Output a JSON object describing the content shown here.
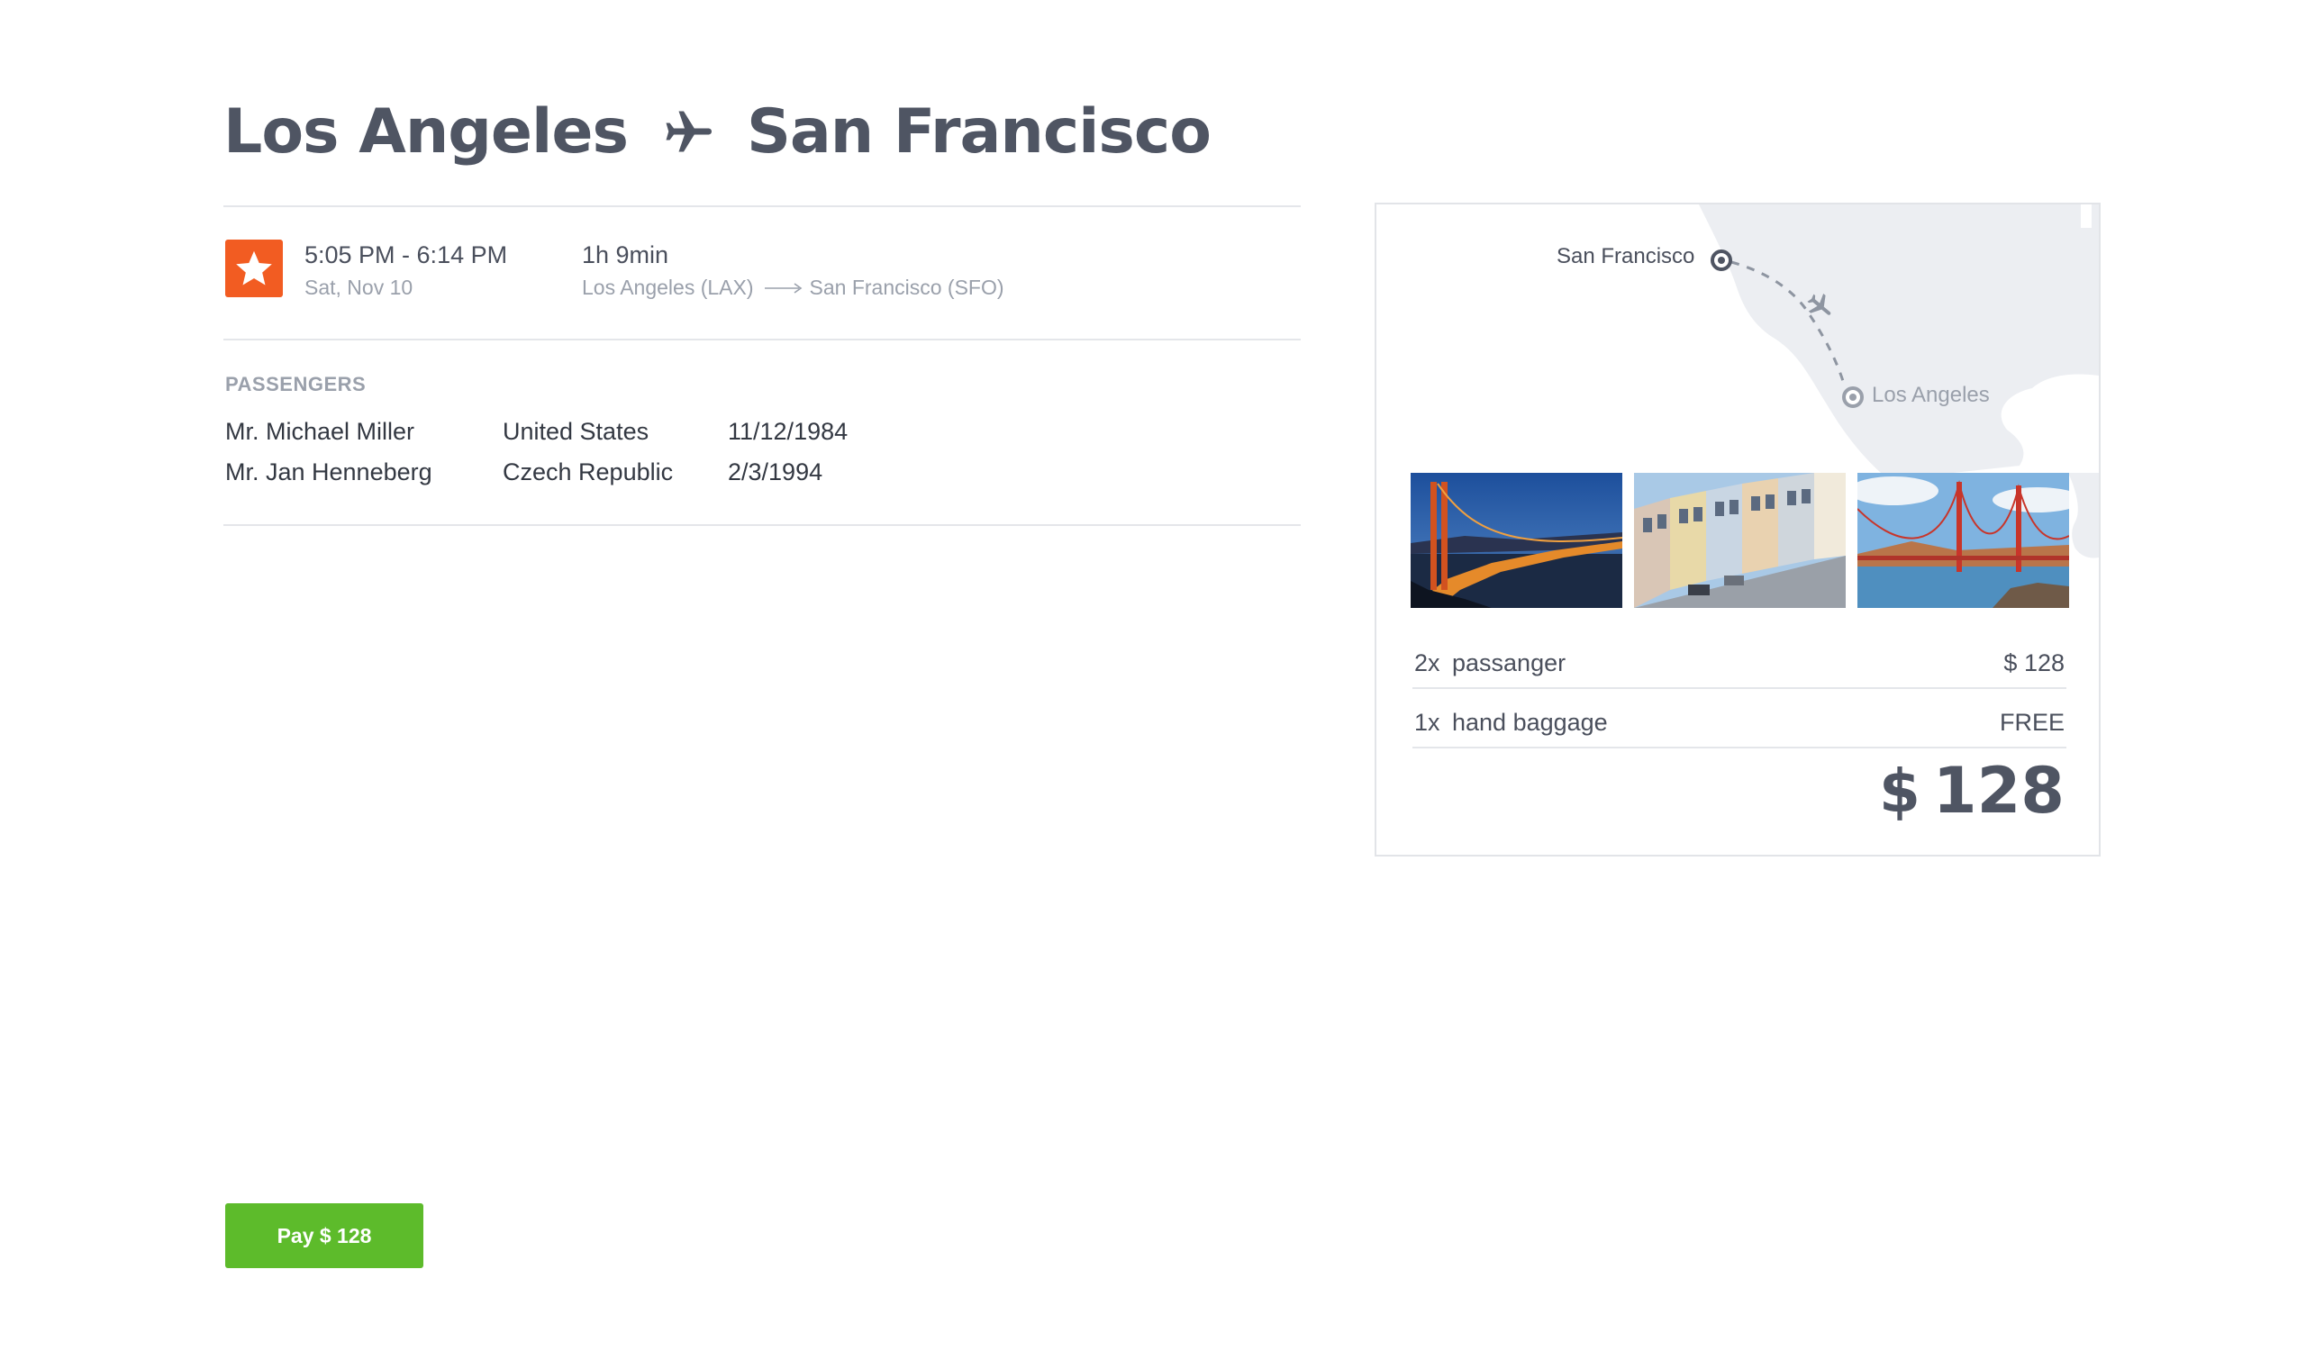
{
  "header": {
    "origin": "Los Angeles",
    "destination": "San Francisco",
    "plane_icon": "plane-icon"
  },
  "flight": {
    "airline_icon": "star-logo-icon",
    "airline_color": "#f25c22",
    "time": "5:05 PM - 6:14 PM",
    "date": "Sat, Nov 10",
    "duration": "1h 9min",
    "from": "Los Angeles (LAX)",
    "to": "San Francisco (SFO)"
  },
  "passengers": {
    "heading": "PASSENGERS",
    "rows": [
      {
        "name": "Mr. Michael Miller",
        "country": "United States",
        "dob": "11/12/1984"
      },
      {
        "name": "Mr. Jan Henneberg",
        "country": "Czech Republic",
        "dob": "2/3/1994"
      }
    ]
  },
  "pay_button": {
    "label": "Pay $ 128",
    "color": "#5dbb2b"
  },
  "summary": {
    "map": {
      "city_from": "Los Angeles",
      "city_to": "San Francisco"
    },
    "photos": [
      "golden-gate-bridge-night-photo",
      "san-francisco-street-photo",
      "golden-gate-bridge-day-photo"
    ],
    "items": [
      {
        "qty": "2x",
        "desc": "passanger",
        "amount": "$ 128"
      },
      {
        "qty": "1x",
        "desc": "hand baggage",
        "amount": "FREE"
      }
    ],
    "total_currency": "$",
    "total_value": "128"
  }
}
